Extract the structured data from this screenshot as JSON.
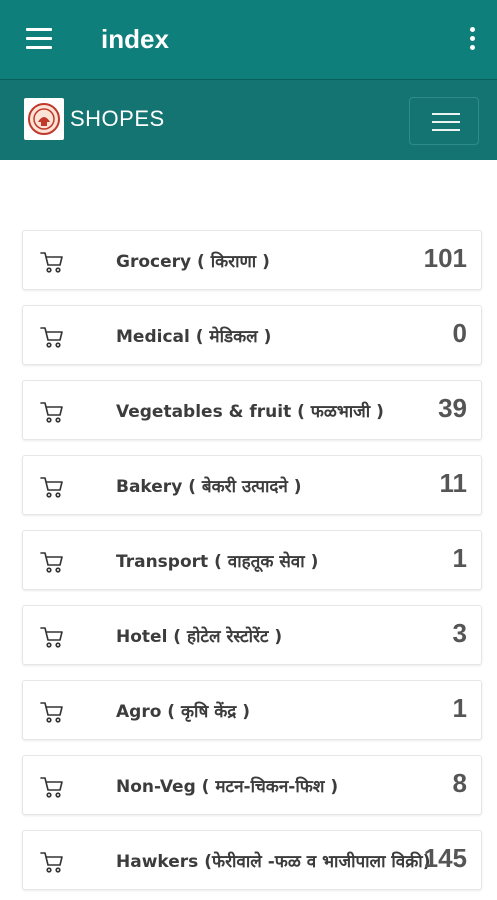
{
  "appbar": {
    "title": "index",
    "menu_icon": "hamburger-menu-icon",
    "overflow_icon": "more-vertical-icon"
  },
  "subbar": {
    "brand": "SHOPES",
    "logo_icon": "municipal-seal-logo",
    "toggle_icon": "hamburger-menu-icon"
  },
  "categories": [
    {
      "label": "Grocery ( किराणा )",
      "count": "101"
    },
    {
      "label": "Medical ( मेडिकल )",
      "count": "0"
    },
    {
      "label": "Vegetables & fruit ( फळभाजी )",
      "count": "39"
    },
    {
      "label": "Bakery ( बेकरी उत्पादने )",
      "count": "11"
    },
    {
      "label": "Transport ( वाहतूक सेवा )",
      "count": "1"
    },
    {
      "label": "Hotel ( होटेल रेस्टोरेंट )",
      "count": "3"
    },
    {
      "label": "Agro ( कृषि केंद्र )",
      "count": "1"
    },
    {
      "label": "Non-Veg ( मटन-चिकन-फिश )",
      "count": "8"
    },
    {
      "label": "Hawkers (फेरीवाले -फळ व भाजीपाला विक्री)",
      "count": "145"
    }
  ],
  "colors": {
    "appbar": "#0e7f7b",
    "subbar": "#147472"
  }
}
